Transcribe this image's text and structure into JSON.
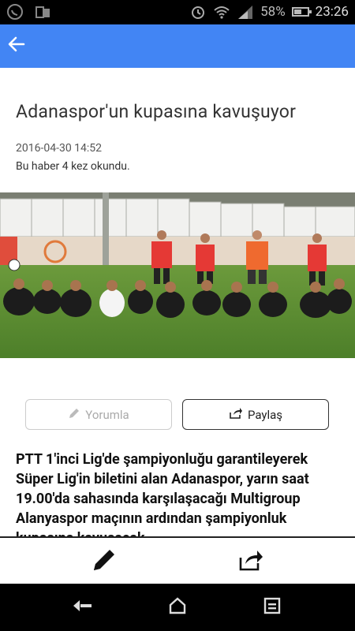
{
  "status_bar": {
    "battery_percent": "58%",
    "battery_level": 0.58,
    "time": "23:26",
    "icons": [
      "whatsapp-icon",
      "sim-icon",
      "alarm-icon",
      "wifi-icon",
      "signal-icon",
      "battery-icon"
    ]
  },
  "app_bar": {
    "color": "#4285f4",
    "back_icon": "arrow-left-icon"
  },
  "article": {
    "title": "Adanaspor'un kupasına kavuşuyor",
    "date": "2016-04-30 14:52",
    "views": "Bu haber 4 kez okundu.",
    "photo_icon": "team-training-photo",
    "body": "PTT 1'inci Lig'de şampiyonluğu garantileyerek Süper Lig'in biletini alan Adanaspor, yarın saat 19.00'da sahasında karşılaşacağı Multigroup Alanyaspor maçının ardından şampiyonluk kupasına kavuşacak."
  },
  "actions": {
    "comment_label": "Yorumla",
    "share_label": "Paylaş"
  },
  "bottom_toolbar": {
    "icons": [
      "pencil-icon",
      "share-icon"
    ]
  },
  "nav_bar": {
    "icons": [
      "back-icon",
      "home-icon",
      "recents-icon"
    ]
  }
}
